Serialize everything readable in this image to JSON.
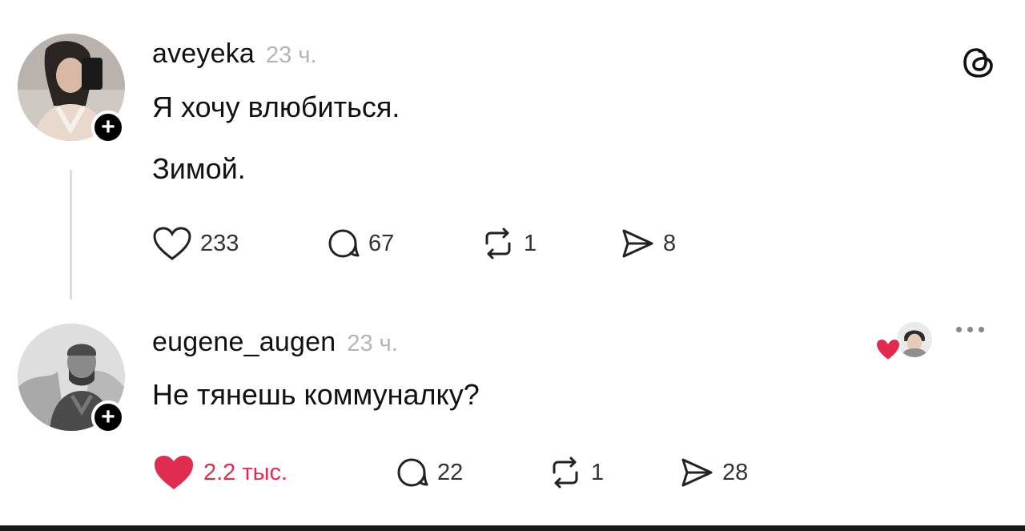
{
  "app": {
    "logo_icon": "threads-logo-icon"
  },
  "posts": [
    {
      "username": "aveyeka",
      "time": "23 ч.",
      "lines": [
        "Я хочу влюбиться.",
        "Зимой."
      ],
      "likes": "233",
      "replies": "67",
      "reposts": "1",
      "shares": "8",
      "liked": false
    },
    {
      "username": "eugene_augen",
      "time": "23 ч.",
      "lines": [
        "Не тянешь коммуналку?"
      ],
      "likes": "2.2 тыс.",
      "replies": "22",
      "reposts": "1",
      "shares": "28",
      "liked": true
    }
  ],
  "colors": {
    "like_red": "#e02c4f",
    "muted": "#b5b5b5",
    "text": "#111111"
  }
}
